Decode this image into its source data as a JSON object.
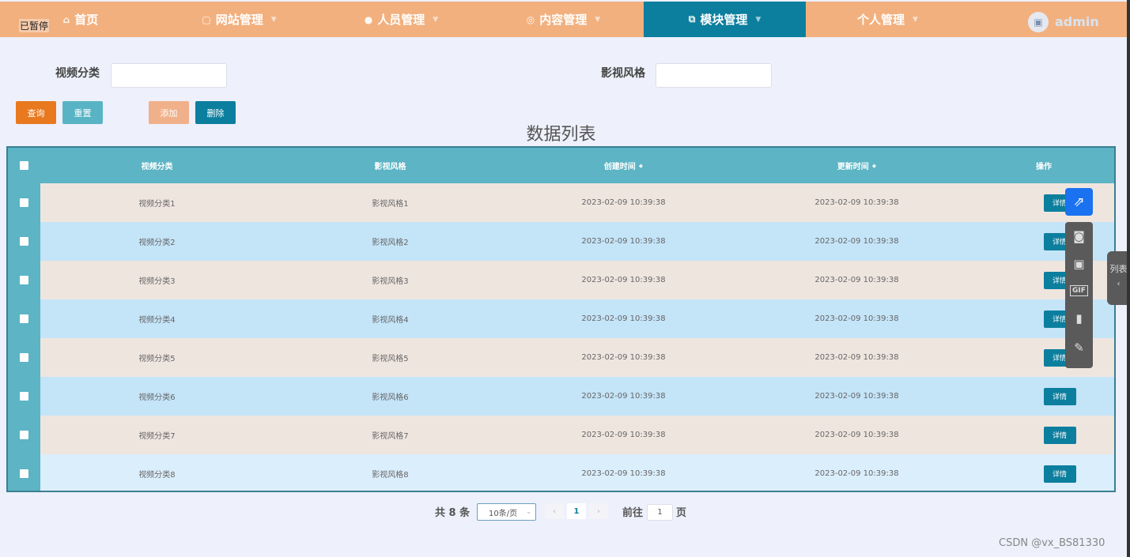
{
  "nav": {
    "paused": "已暂停",
    "items": [
      {
        "label": "首页",
        "icon": "home-icon",
        "glyph": "⌂"
      },
      {
        "label": "网站管理",
        "icon": "cart-icon",
        "glyph": "▢"
      },
      {
        "label": "人员管理",
        "icon": "user-icon",
        "glyph": "●"
      },
      {
        "label": "内容管理",
        "icon": "clock-icon",
        "glyph": "◎"
      },
      {
        "label": "模块管理",
        "icon": "copy-icon",
        "glyph": "⧉"
      },
      {
        "label": "个人管理",
        "icon": "",
        "glyph": ""
      }
    ],
    "active_index": 4,
    "user": "admin"
  },
  "search": {
    "field1_label": "视频分类",
    "field1_value": "",
    "field2_label": "影视风格",
    "field2_value": ""
  },
  "actions": {
    "query": "查询",
    "reset": "重置",
    "add": "添加",
    "delete": "删除"
  },
  "list_title": "数据列表",
  "table": {
    "headers": [
      "视频分类",
      "影视风格",
      "创建时间",
      "更新时间",
      "操作"
    ],
    "detail_label": "详情",
    "rows": [
      {
        "category": "视频分类1",
        "style": "影视风格1",
        "created": "2023-02-09 10:39:38",
        "updated": "2023-02-09 10:39:38"
      },
      {
        "category": "视频分类2",
        "style": "影视风格2",
        "created": "2023-02-09 10:39:38",
        "updated": "2023-02-09 10:39:38"
      },
      {
        "category": "视频分类3",
        "style": "影视风格3",
        "created": "2023-02-09 10:39:38",
        "updated": "2023-02-09 10:39:38"
      },
      {
        "category": "视频分类4",
        "style": "影视风格4",
        "created": "2023-02-09 10:39:38",
        "updated": "2023-02-09 10:39:38"
      },
      {
        "category": "视频分类5",
        "style": "影视风格5",
        "created": "2023-02-09 10:39:38",
        "updated": "2023-02-09 10:39:38"
      },
      {
        "category": "视频分类6",
        "style": "影视风格6",
        "created": "2023-02-09 10:39:38",
        "updated": "2023-02-09 10:39:38"
      },
      {
        "category": "视频分类7",
        "style": "影视风格7",
        "created": "2023-02-09 10:39:38",
        "updated": "2023-02-09 10:39:38"
      },
      {
        "category": "视频分类8",
        "style": "影视风格8",
        "created": "2023-02-09 10:39:38",
        "updated": "2023-02-09 10:39:38"
      }
    ]
  },
  "pagination": {
    "total": "共 8 条",
    "page_size": "10条/页",
    "current_page": "1",
    "goto_prefix": "前往",
    "goto_value": "1",
    "goto_suffix": "页"
  },
  "overlay": {
    "side_tab_label": "列表",
    "watermark": "CSDN @vx_BS81330",
    "gif_label": "GIF"
  },
  "colors": {
    "nav_bg": "#f2b07e",
    "nav_active": "#0c7f9f",
    "table_header": "#5cb4c4",
    "row_odd": "#efe5df",
    "row_even": "#c4e4f8",
    "btn_query": "#e8791f",
    "btn_reset": "#58b4c4",
    "btn_add": "#f0b08a",
    "btn_delete": "#0c7f9f"
  }
}
